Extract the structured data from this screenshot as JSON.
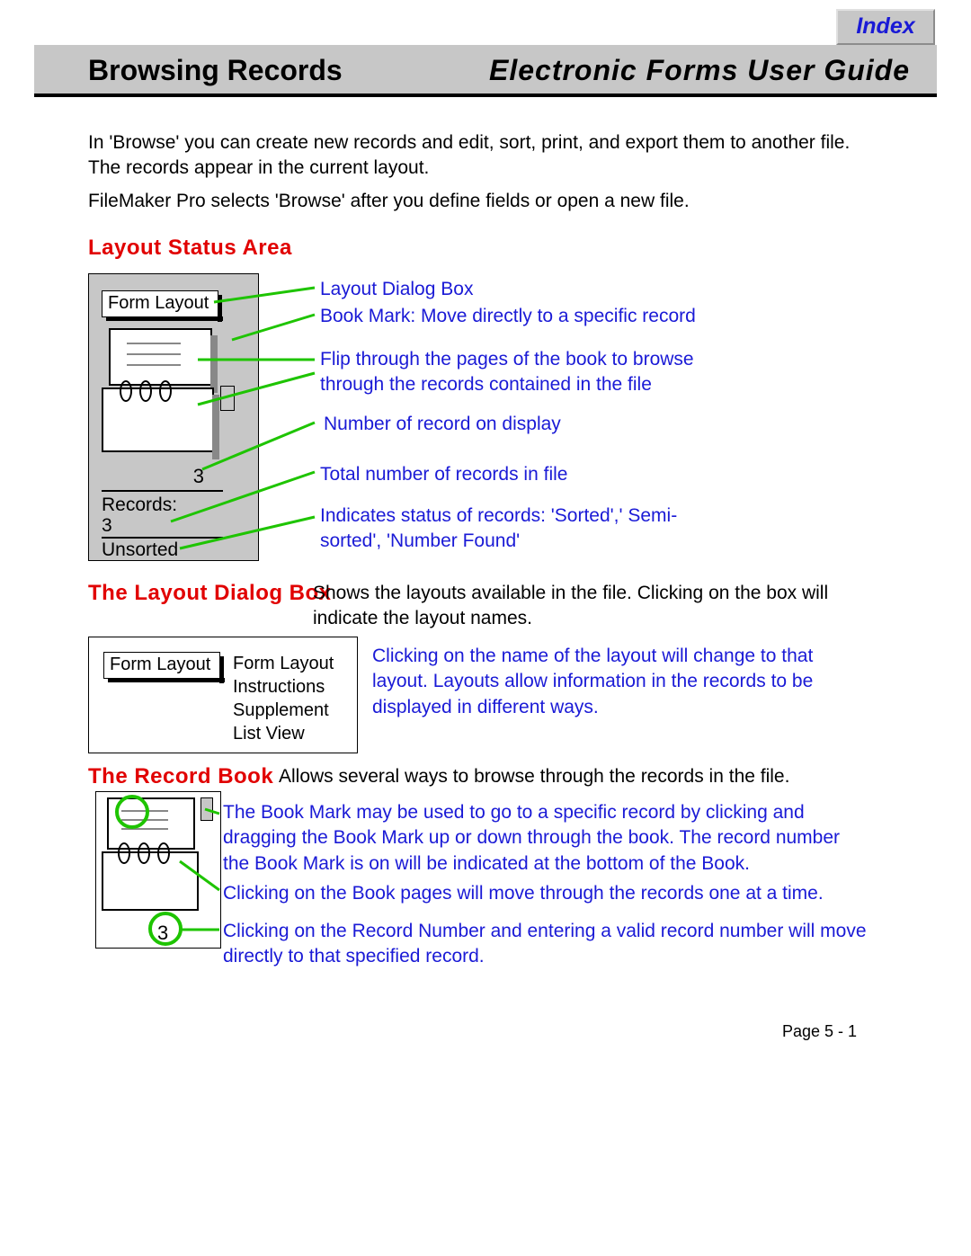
{
  "index_label": "Index",
  "header": {
    "section": "Browsing Records",
    "guide": "Electronic Forms User Guide"
  },
  "intro_p1": "In 'Browse' you can create new records and edit, sort, print, and export them to another file. The records appear in the current layout.",
  "intro_p2": "FileMaker Pro selects 'Browse' after you define fields or open a new file.",
  "headings": {
    "layout_status": "Layout Status Area",
    "layout_dialog": "The Layout Dialog Box",
    "record_book": "The Record Book"
  },
  "status_panel": {
    "layout_btn": "Form Layout",
    "record_num": "3",
    "records_label": "Records:",
    "records_count": "3",
    "sort_status": "Unsorted"
  },
  "callouts": {
    "c1": "Layout Dialog Box",
    "c2": "Book Mark:  Move directly to a specific record",
    "c3": "Flip through the pages of the book to browse through the records contained in the file",
    "c4": "Number of record on display",
    "c5": "Total number of records in file",
    "c6": "Indicates status of records: 'Sorted',' Semi-sorted', 'Number Found'"
  },
  "dialog_desc": "Shows the layouts available in the file. Clicking on the box will indicate the layout names.",
  "dialog_panel": {
    "btn": "Form Layout",
    "list": [
      "Form Layout",
      "Instructions",
      "Supplement",
      "List View"
    ]
  },
  "dialog_note": "Clicking on the name of the layout will change to that layout. Layouts allow information in the records to be displayed in different ways.",
  "record_book_desc": "Allows several ways to browse through the records in the file.",
  "book2": {
    "record_num": "3"
  },
  "book_notes": {
    "n1": "The Book Mark may be used to go to a specific record by clicking and dragging the Book Mark up or down through the book. The record number the Book Mark is on will be indicated at the bottom of the Book.",
    "n2": "Clicking on the Book pages will move through the records one at a time.",
    "n3": "Clicking on the Record Number and entering a valid record number will move directly to that specified record."
  },
  "page_num": "Page  5 - 1"
}
